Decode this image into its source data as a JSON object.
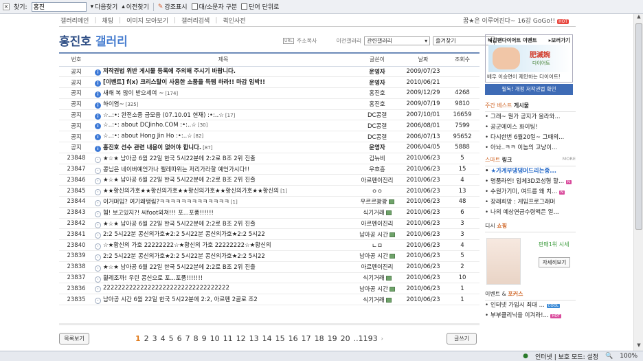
{
  "findbar": {
    "label": "찾기:",
    "query": "홍진",
    "next": "다음찾기",
    "prev": "이전찾기",
    "highlight": "강조표시",
    "case": "대/소문자 구분",
    "whole_word": "단어 단위로"
  },
  "topnav": {
    "items": [
      "갤러리메인",
      "채팅",
      "이미지 모아보기",
      "갤러리검색",
      "퀵인사전"
    ],
    "slogan": "꿈★은 이루어진다~ 16강 GoGo!!",
    "hot": "HOT"
  },
  "header": {
    "name": "홍진호",
    "suffix": "갤러리",
    "copy_address": "주소복사",
    "prev_gallery": "이전갤러리",
    "related": "관련갤러리",
    "favorites": "즐겨찾기"
  },
  "table": {
    "columns": [
      "번호",
      "제목",
      "글쓴이",
      "날짜",
      "조회수"
    ],
    "rows": [
      {
        "no": "공지",
        "icon": "notice",
        "subject": "저작권법 위반 게시물 등록에 주의해 주시기 바랍니다.",
        "count": "",
        "writer": "운영자",
        "date": "2009/07/23",
        "hits": "",
        "bold": true
      },
      {
        "no": "공지",
        "icon": "notice",
        "subject": "[이벤트] f(x) 크리스탈이 사용한 소품을 득템 하라!! 마감 임박!!",
        "count": "",
        "writer": "운영자",
        "date": "2010/06/21",
        "hits": "",
        "bold": true
      },
      {
        "no": "공지",
        "icon": "notice",
        "subject": "새해 복 많이 받으세여 ~",
        "count": "[174]",
        "writer": "홍진호",
        "date": "2009/12/29",
        "hits": "4268",
        "bold": false
      },
      {
        "no": "공지",
        "icon": "notice",
        "subject": "하이염~",
        "count": "[325]",
        "writer": "홍진호",
        "date": "2009/07/19",
        "hits": "9810",
        "bold": false
      },
      {
        "no": "공지",
        "icon": "notice",
        "subject": "☆..:•: 완전소중 금모음 (07.10.01 현재) :•:..☆",
        "count": "[17]",
        "writer": "DC콩갤",
        "date": "2007/10/01",
        "hits": "16659",
        "bold": false
      },
      {
        "no": "공지",
        "icon": "notice",
        "subject": "☆..:•: about DCJinho.COM :•:..☆",
        "count": "[30]",
        "writer": "DC콩갤",
        "date": "2006/08/01",
        "hits": "7599",
        "bold": false
      },
      {
        "no": "공지",
        "icon": "notice",
        "subject": "☆..:•: about Hong Jin Ho :•:..☆",
        "count": "[82]",
        "writer": "DC콩갤",
        "date": "2006/07/13",
        "hits": "95652",
        "bold": false
      },
      {
        "no": "공지",
        "icon": "notice",
        "subject": "홍진호 선수 관련 내용이 없어야 합니다.",
        "count": "[87]",
        "writer": "운영자",
        "date": "2006/04/05",
        "hits": "5888",
        "bold": true
      },
      {
        "no": "23848",
        "icon": "post",
        "subject": "★☆★ 남아공 6월 22일 한국 5시22분에 2:2로 B조 2위 진출",
        "count": "",
        "writer": "김뉴비",
        "date": "2010/06/23",
        "hits": "5",
        "bold": false
      },
      {
        "no": "23847",
        "icon": "post",
        "subject": "콩님은 네이버예언가나 펠레따위는 저리가라할 예언가시다!!",
        "count": "",
        "writer": "우흐흥",
        "date": "2010/06/23",
        "hits": "15",
        "bold": false
      },
      {
        "no": "23846",
        "icon": "post",
        "subject": "★☆★ 남아공 6월 22일 한국 5시22분에 2:2로 B조 2위 진출",
        "count": "",
        "writer": "아르펜이진리",
        "date": "2010/06/23",
        "hits": "4",
        "bold": false
      },
      {
        "no": "23845",
        "icon": "post",
        "subject": "★★황신의가호★★황신의가호★★황신의가호★★황신의가호★★황신의",
        "count": "[1]",
        "writer": "ㅇㅇ",
        "date": "2010/06/23",
        "hits": "13",
        "bold": false
      },
      {
        "no": "23844",
        "icon": "post",
        "subject": "이거머임? 여기왜탱림?ㅋㅋㅋㅋㅋㅋㅋㅋㅋㅋㅋㅋㅋ",
        "count": "[1]",
        "writer": "우르르쾅쾅",
        "date": "2010/06/23",
        "hits": "48",
        "bold": false,
        "pic": true
      },
      {
        "no": "23843",
        "icon": "post",
        "subject": "혐! 보고있지?! 씨foot외쳐!!! 포...포풍!!!!!!",
        "count": "",
        "writer": "식기거래",
        "date": "2010/06/23",
        "hits": "6",
        "bold": false,
        "pic": true
      },
      {
        "no": "23842",
        "icon": "post",
        "subject": "★☆★ 남아공 6월 22일 한국 5시22분에 2:2로 B조 2위 진출",
        "count": "",
        "writer": "아르펜이진리",
        "date": "2010/06/23",
        "hits": "3",
        "bold": false
      },
      {
        "no": "23841",
        "icon": "post",
        "subject": "2:2 5시22분 콩신의가호★2:2 5시22분 콩신의가호★2:2 5시22",
        "count": "",
        "writer": "남아공 시간",
        "date": "2010/06/23",
        "hits": "3",
        "bold": false,
        "pic": true
      },
      {
        "no": "23840",
        "icon": "post",
        "subject": "☆★황신의 가호 22222222☆★황신의 가호 22222222☆★황신의",
        "count": "",
        "writer": "ㄴㅁ",
        "date": "2010/06/23",
        "hits": "4",
        "bold": false
      },
      {
        "no": "23839",
        "icon": "post",
        "subject": "2:2 5시22분 콩신의가호★2:2 5시22분 콩신의가호★2:2 5시22",
        "count": "",
        "writer": "남아공 시간",
        "date": "2010/06/23",
        "hits": "5",
        "bold": false,
        "pic": true
      },
      {
        "no": "23838",
        "icon": "post",
        "subject": "★☆★ 남아공 6월 22일 한국 5시22분에 2:2로 B조 2위 진출",
        "count": "",
        "writer": "아르펜이진리",
        "date": "2010/06/23",
        "hits": "2",
        "bold": false
      },
      {
        "no": "23837",
        "icon": "post",
        "subject": "휠레조까! 우린 콩신으로 포...포풍!!!!!!!",
        "count": "",
        "writer": "식기거래",
        "date": "2010/06/23",
        "hits": "10",
        "bold": false,
        "pic": true
      },
      {
        "no": "23836",
        "icon": "post",
        "subject": "2222222222222222222222222222222222",
        "count": "",
        "writer": "남아공 시간",
        "date": "2010/06/23",
        "hits": "1",
        "bold": false,
        "pic": true
      },
      {
        "no": "23835",
        "icon": "post",
        "subject": "남아공 시간 6월 22일 한국 5시22분에 2:2, 아르펜 2골로 조2",
        "count": "",
        "writer": "식기거래",
        "date": "2010/06/23",
        "hits": "1",
        "bold": false,
        "pic": true
      }
    ]
  },
  "footer": {
    "list_button": "목록보기",
    "write_button": "글쓰기",
    "pages": [
      "1",
      "2",
      "3",
      "4",
      "5",
      "6",
      "7",
      "8",
      "9",
      "10",
      "11",
      "12",
      "13",
      "14",
      "15",
      "16",
      "17",
      "18",
      "19",
      "20"
    ],
    "ellipsis": "..1193",
    "next": "›"
  },
  "sidebar": {
    "banner_title": "비갑팬다이어트 이벤트",
    "banner_more": "▸보러가기",
    "banner_text": "肥滅婉",
    "banner_sub": "다이어트",
    "banner_caption": "배우 이승연이 제안하는 다이어트!",
    "notice_button": "필독! 개정 저작권법 확인",
    "weekly_title": "주간 베스트",
    "weekly_bold": "게시물",
    "weekly": [
      "그래~ 뭔가 공지가 올라와...",
      "공군에이스 화이팅!",
      "다시한번 6월20일~ 그때의...",
      "아놔..ㅋㅋ 이놈의 고냥이..."
    ],
    "smart_title": "스마트",
    "smart_bold": "링크",
    "smart_more": "MORE",
    "smart": [
      "★가계부댕댕머드리는종...",
      "명품라인! 입체3D코성형 할...",
      "수원가기미, 여드름 왜 치...",
      "장래희망 : 게임프로그래머",
      "나의 예상연금수령액은 얼..."
    ],
    "shop_title": "디시",
    "shop_bold": "쇼핑",
    "shop_line": "판매1위 시세",
    "shop_btn": "자세히보기",
    "event_title": "이벤트 &",
    "event_bold": "포커스",
    "events": [
      "인터넷 가입시 최대 ...",
      "부부클리닉을 이겨라!..."
    ],
    "event_tags": [
      "COOL",
      "HOT"
    ],
    "tag_new": "N"
  },
  "status": {
    "zone": "인터넷 | 보호 모드: 설정",
    "zoom": "100%"
  }
}
